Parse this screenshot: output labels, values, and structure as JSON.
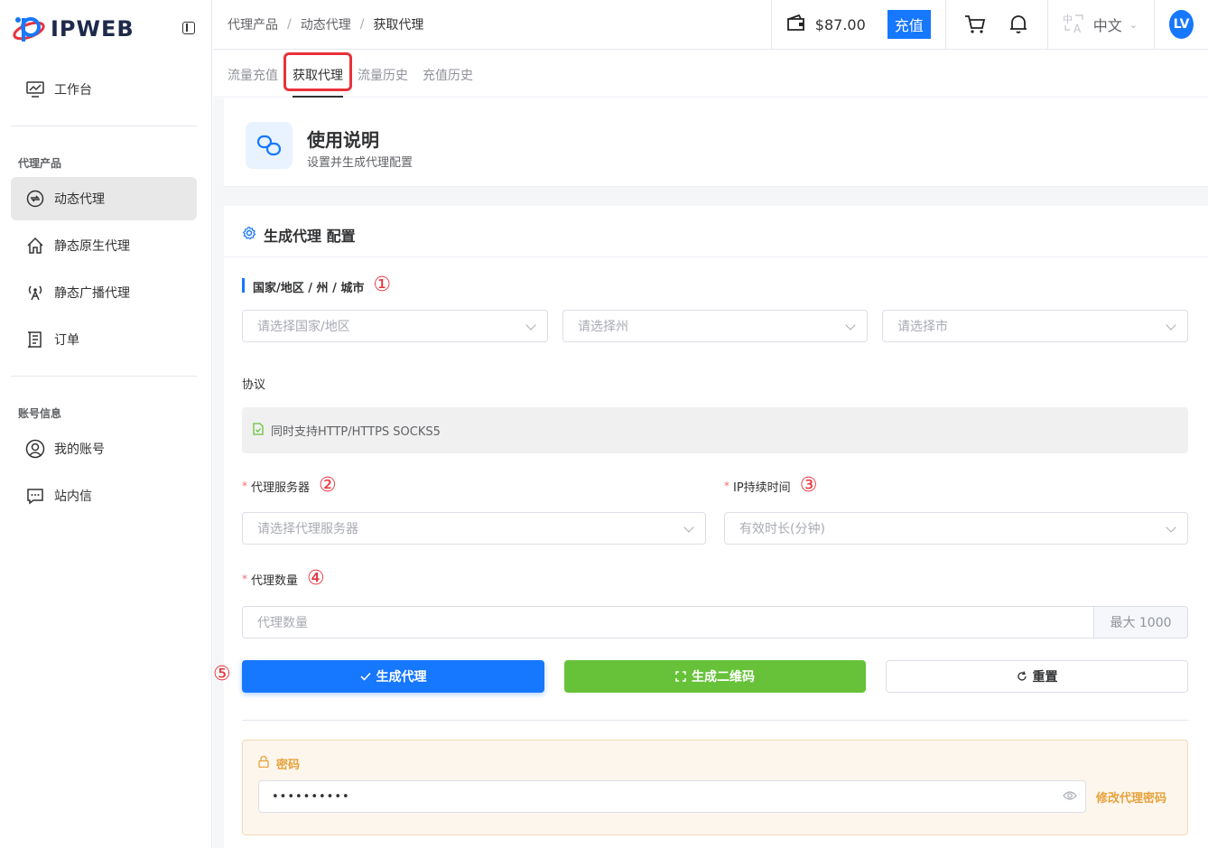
{
  "brand": {
    "name": "IPWEB"
  },
  "sidebar": {
    "workbench": "工作台",
    "group_proxy": "代理产品",
    "group_account": "账号信息",
    "items": [
      {
        "label": "动态代理",
        "icon": "dynamic-proxy-icon",
        "active": true
      },
      {
        "label": "静态原生代理",
        "icon": "home-icon"
      },
      {
        "label": "静态广播代理",
        "icon": "antenna-icon"
      },
      {
        "label": "订单",
        "icon": "order-icon"
      },
      {
        "label": "我的账号",
        "icon": "user-icon"
      },
      {
        "label": "站内信",
        "icon": "message-icon"
      }
    ]
  },
  "header": {
    "breadcrumb": [
      "代理产品",
      "动态代理",
      "获取代理"
    ],
    "separator": "/",
    "balance": "$87.00",
    "recharge": "充值",
    "language": "中文",
    "avatar": "LV"
  },
  "tabs": [
    "流量充值",
    "获取代理",
    "流量历史",
    "充值历史"
  ],
  "active_tab": "获取代理",
  "intro": {
    "title": "使用说明",
    "subtitle": "设置并生成代理配置"
  },
  "section_title": "生成代理 配置",
  "location": {
    "label": "国家/地区 / 州 / 城市",
    "marker": "①",
    "country_placeholder": "请选择国家/地区",
    "state_placeholder": "请选择州",
    "city_placeholder": "请选择市"
  },
  "protocol": {
    "label": "协议",
    "value": "同时支持HTTP/HTTPS SOCKS5"
  },
  "server": {
    "label": "代理服务器",
    "marker": "②",
    "placeholder": "请选择代理服务器"
  },
  "duration": {
    "label": "IP持续时间",
    "marker": "③",
    "placeholder": "有效时长(分钟)"
  },
  "quantity": {
    "label": "代理数量",
    "marker": "④",
    "placeholder": "代理数量",
    "addon": "最大 1000"
  },
  "actions": {
    "marker": "⑤",
    "generate": "生成代理",
    "qrcode": "生成二维码",
    "reset": "重置"
  },
  "password": {
    "label": "密码",
    "value": "••••••••••",
    "change": "修改代理密码"
  },
  "colors": {
    "primary": "#1677ff",
    "success": "#67c23a",
    "warning": "#e6a23c",
    "danger": "#e8323b"
  }
}
